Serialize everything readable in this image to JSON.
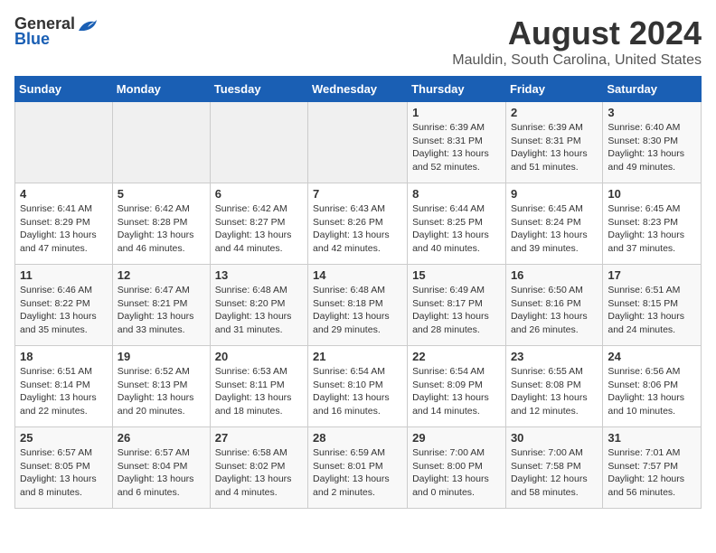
{
  "header": {
    "logo_general": "General",
    "logo_blue": "Blue",
    "month_year": "August 2024",
    "location": "Mauldin, South Carolina, United States"
  },
  "weekdays": [
    "Sunday",
    "Monday",
    "Tuesday",
    "Wednesday",
    "Thursday",
    "Friday",
    "Saturday"
  ],
  "weeks": [
    [
      {
        "day": "",
        "info": ""
      },
      {
        "day": "",
        "info": ""
      },
      {
        "day": "",
        "info": ""
      },
      {
        "day": "",
        "info": ""
      },
      {
        "day": "1",
        "info": "Sunrise: 6:39 AM\nSunset: 8:31 PM\nDaylight: 13 hours\nand 52 minutes."
      },
      {
        "day": "2",
        "info": "Sunrise: 6:39 AM\nSunset: 8:31 PM\nDaylight: 13 hours\nand 51 minutes."
      },
      {
        "day": "3",
        "info": "Sunrise: 6:40 AM\nSunset: 8:30 PM\nDaylight: 13 hours\nand 49 minutes."
      }
    ],
    [
      {
        "day": "4",
        "info": "Sunrise: 6:41 AM\nSunset: 8:29 PM\nDaylight: 13 hours\nand 47 minutes."
      },
      {
        "day": "5",
        "info": "Sunrise: 6:42 AM\nSunset: 8:28 PM\nDaylight: 13 hours\nand 46 minutes."
      },
      {
        "day": "6",
        "info": "Sunrise: 6:42 AM\nSunset: 8:27 PM\nDaylight: 13 hours\nand 44 minutes."
      },
      {
        "day": "7",
        "info": "Sunrise: 6:43 AM\nSunset: 8:26 PM\nDaylight: 13 hours\nand 42 minutes."
      },
      {
        "day": "8",
        "info": "Sunrise: 6:44 AM\nSunset: 8:25 PM\nDaylight: 13 hours\nand 40 minutes."
      },
      {
        "day": "9",
        "info": "Sunrise: 6:45 AM\nSunset: 8:24 PM\nDaylight: 13 hours\nand 39 minutes."
      },
      {
        "day": "10",
        "info": "Sunrise: 6:45 AM\nSunset: 8:23 PM\nDaylight: 13 hours\nand 37 minutes."
      }
    ],
    [
      {
        "day": "11",
        "info": "Sunrise: 6:46 AM\nSunset: 8:22 PM\nDaylight: 13 hours\nand 35 minutes."
      },
      {
        "day": "12",
        "info": "Sunrise: 6:47 AM\nSunset: 8:21 PM\nDaylight: 13 hours\nand 33 minutes."
      },
      {
        "day": "13",
        "info": "Sunrise: 6:48 AM\nSunset: 8:20 PM\nDaylight: 13 hours\nand 31 minutes."
      },
      {
        "day": "14",
        "info": "Sunrise: 6:48 AM\nSunset: 8:18 PM\nDaylight: 13 hours\nand 29 minutes."
      },
      {
        "day": "15",
        "info": "Sunrise: 6:49 AM\nSunset: 8:17 PM\nDaylight: 13 hours\nand 28 minutes."
      },
      {
        "day": "16",
        "info": "Sunrise: 6:50 AM\nSunset: 8:16 PM\nDaylight: 13 hours\nand 26 minutes."
      },
      {
        "day": "17",
        "info": "Sunrise: 6:51 AM\nSunset: 8:15 PM\nDaylight: 13 hours\nand 24 minutes."
      }
    ],
    [
      {
        "day": "18",
        "info": "Sunrise: 6:51 AM\nSunset: 8:14 PM\nDaylight: 13 hours\nand 22 minutes."
      },
      {
        "day": "19",
        "info": "Sunrise: 6:52 AM\nSunset: 8:13 PM\nDaylight: 13 hours\nand 20 minutes."
      },
      {
        "day": "20",
        "info": "Sunrise: 6:53 AM\nSunset: 8:11 PM\nDaylight: 13 hours\nand 18 minutes."
      },
      {
        "day": "21",
        "info": "Sunrise: 6:54 AM\nSunset: 8:10 PM\nDaylight: 13 hours\nand 16 minutes."
      },
      {
        "day": "22",
        "info": "Sunrise: 6:54 AM\nSunset: 8:09 PM\nDaylight: 13 hours\nand 14 minutes."
      },
      {
        "day": "23",
        "info": "Sunrise: 6:55 AM\nSunset: 8:08 PM\nDaylight: 13 hours\nand 12 minutes."
      },
      {
        "day": "24",
        "info": "Sunrise: 6:56 AM\nSunset: 8:06 PM\nDaylight: 13 hours\nand 10 minutes."
      }
    ],
    [
      {
        "day": "25",
        "info": "Sunrise: 6:57 AM\nSunset: 8:05 PM\nDaylight: 13 hours\nand 8 minutes."
      },
      {
        "day": "26",
        "info": "Sunrise: 6:57 AM\nSunset: 8:04 PM\nDaylight: 13 hours\nand 6 minutes."
      },
      {
        "day": "27",
        "info": "Sunrise: 6:58 AM\nSunset: 8:02 PM\nDaylight: 13 hours\nand 4 minutes."
      },
      {
        "day": "28",
        "info": "Sunrise: 6:59 AM\nSunset: 8:01 PM\nDaylight: 13 hours\nand 2 minutes."
      },
      {
        "day": "29",
        "info": "Sunrise: 7:00 AM\nSunset: 8:00 PM\nDaylight: 13 hours\nand 0 minutes."
      },
      {
        "day": "30",
        "info": "Sunrise: 7:00 AM\nSunset: 7:58 PM\nDaylight: 12 hours\nand 58 minutes."
      },
      {
        "day": "31",
        "info": "Sunrise: 7:01 AM\nSunset: 7:57 PM\nDaylight: 12 hours\nand 56 minutes."
      }
    ]
  ]
}
